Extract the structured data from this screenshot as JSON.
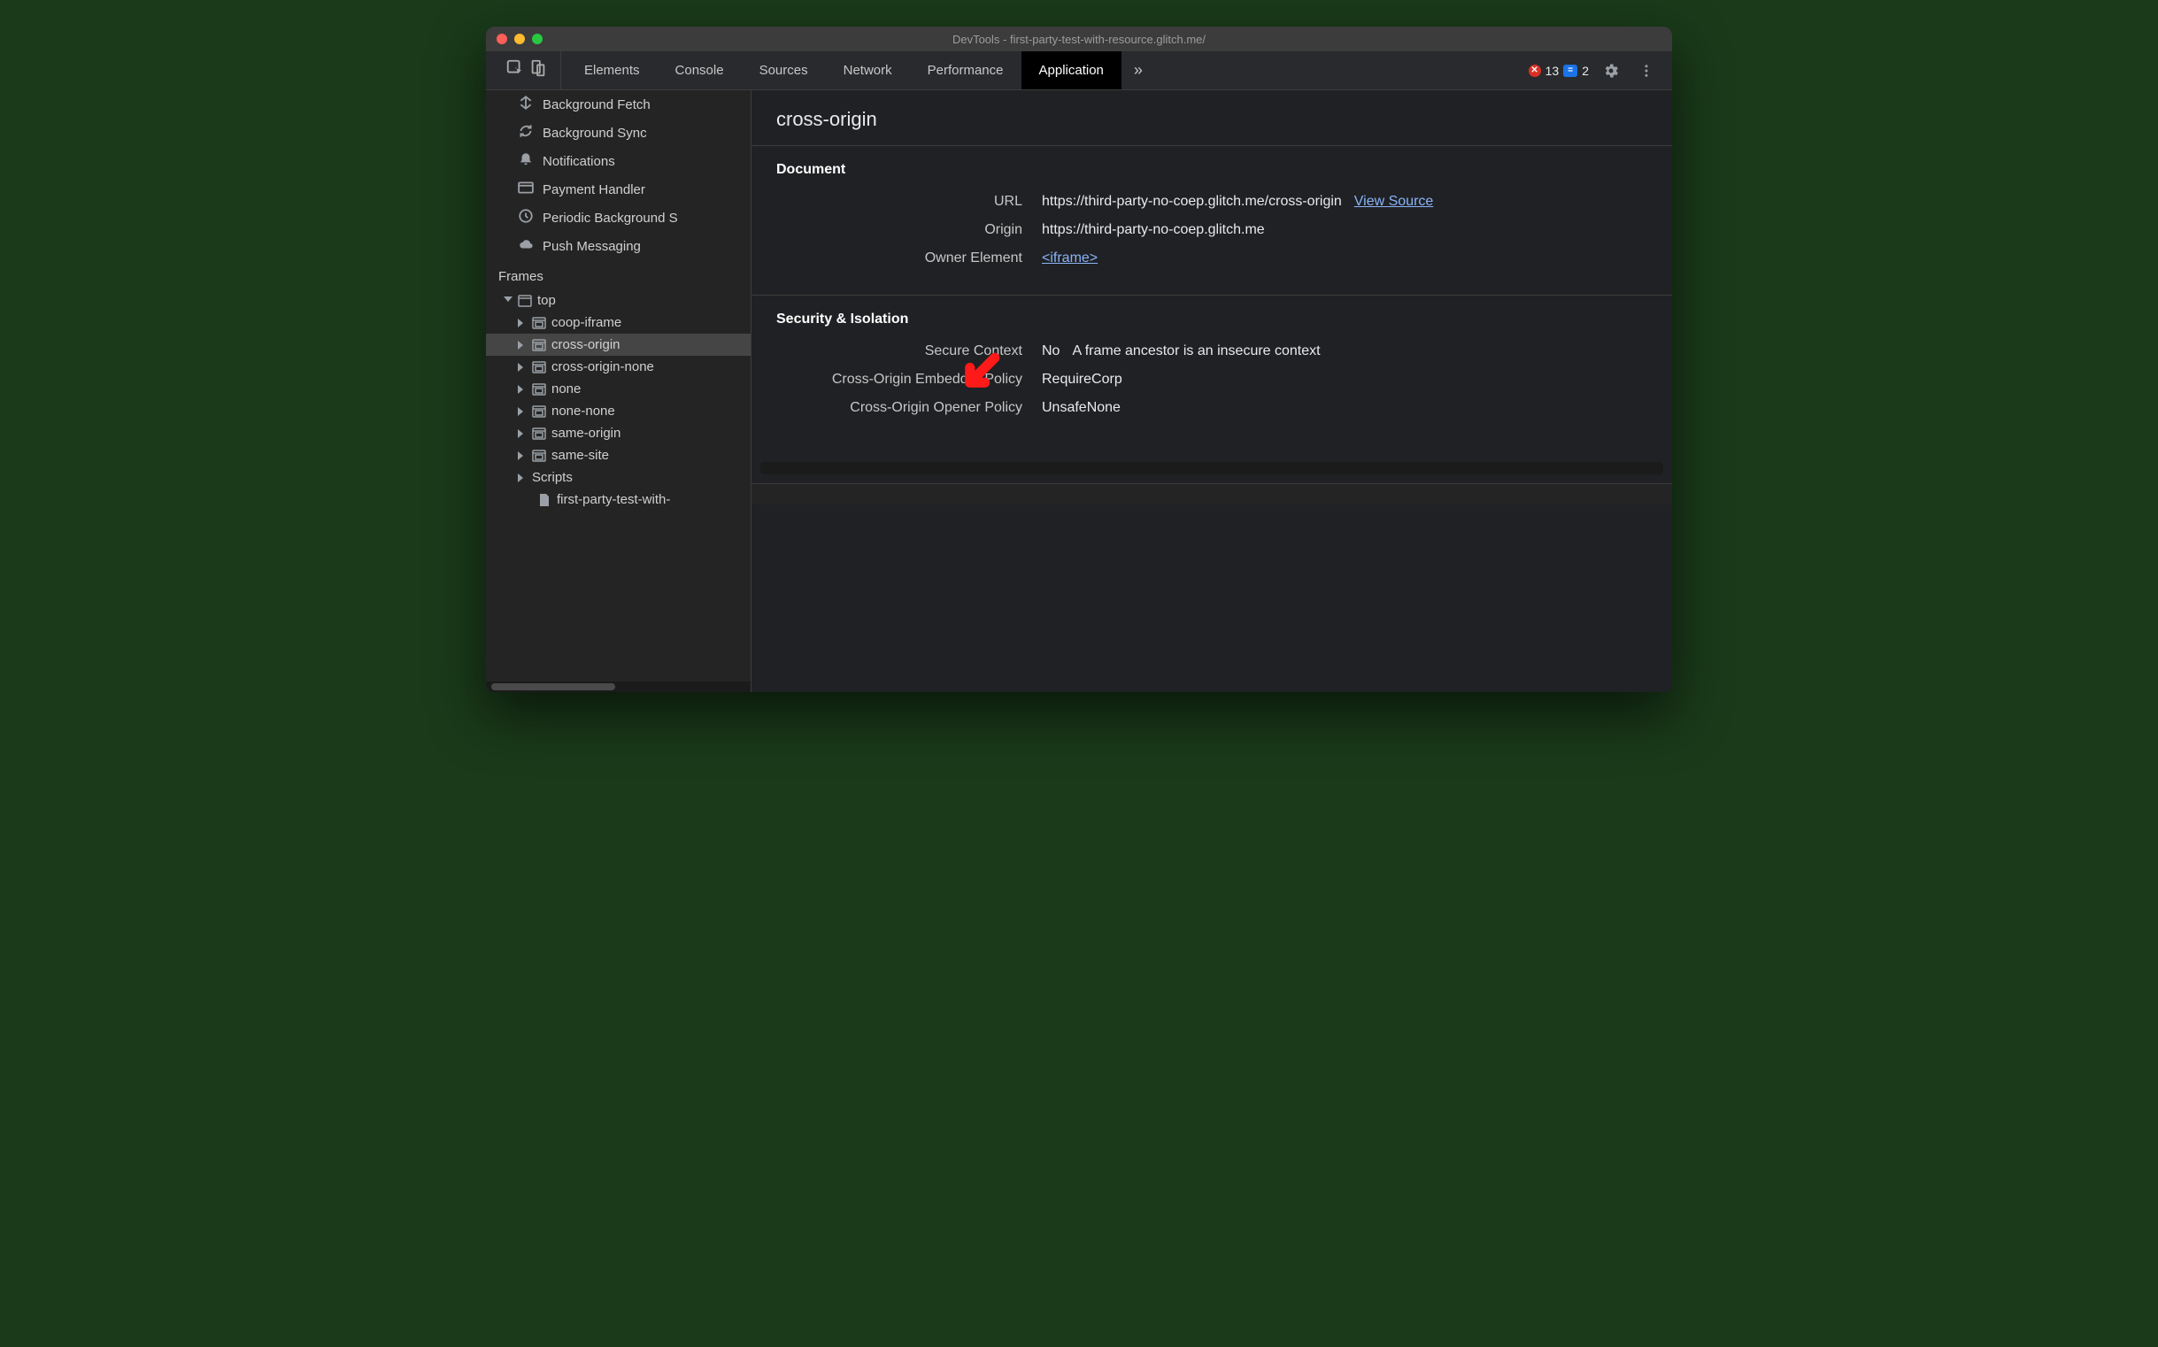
{
  "title": "DevTools - first-party-test-with-resource.glitch.me/",
  "tabs": {
    "items": [
      "Elements",
      "Console",
      "Sources",
      "Network",
      "Performance",
      "Application"
    ],
    "active": "Application"
  },
  "errors": {
    "errCount": "13",
    "infoCount": "2"
  },
  "sidebar": {
    "bg_items": [
      {
        "icon": "fetch",
        "label": "Background Fetch"
      },
      {
        "icon": "sync",
        "label": "Background Sync"
      },
      {
        "icon": "bell",
        "label": "Notifications"
      },
      {
        "icon": "card",
        "label": "Payment Handler"
      },
      {
        "icon": "clock",
        "label": "Periodic Background S"
      },
      {
        "icon": "cloud",
        "label": "Push Messaging"
      }
    ],
    "section": "Frames",
    "tree": {
      "root": "top",
      "children": [
        "coop-iframe",
        "cross-origin",
        "cross-origin-none",
        "none",
        "none-none",
        "same-origin",
        "same-site"
      ],
      "scripts_label": "Scripts",
      "file_label": "first-party-test-with-"
    },
    "selected": "cross-origin"
  },
  "main": {
    "heading": "cross-origin",
    "document": {
      "title": "Document",
      "url_label": "URL",
      "url": "https://third-party-no-coep.glitch.me/cross-origin",
      "view_source": "View Source",
      "origin_label": "Origin",
      "origin": "https://third-party-no-coep.glitch.me",
      "owner_label": "Owner Element",
      "owner_link": "<iframe>"
    },
    "security": {
      "title": "Security & Isolation",
      "secure_label": "Secure Context",
      "secure_value": "No",
      "secure_note": "A frame ancestor is an insecure context",
      "coep_label": "Cross-Origin Embedder Policy",
      "coep_value": "RequireCorp",
      "coop_label": "Cross-Origin Opener Policy",
      "coop_value": "UnsafeNone"
    }
  }
}
